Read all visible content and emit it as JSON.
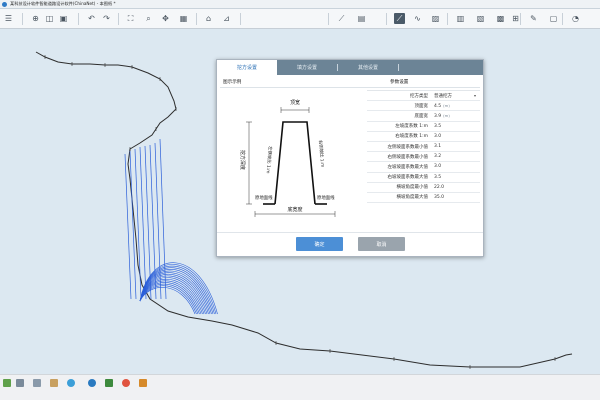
{
  "window": {
    "title": "某科技设计软件智能道路设计软件(ChinaNet) - 本图纸 *"
  },
  "toolbar": {
    "buttons": [
      {
        "name": "menu-icon",
        "glyph": "☰"
      },
      {
        "name": "target-icon",
        "glyph": "⊕"
      },
      {
        "name": "layers-icon",
        "glyph": "◫"
      },
      {
        "name": "save-icon",
        "glyph": "▣"
      },
      {
        "name": "undo-icon",
        "glyph": "↶"
      },
      {
        "name": "redo-icon",
        "glyph": "↷"
      },
      {
        "name": "extents-icon",
        "glyph": "⛶"
      },
      {
        "name": "zoom-icon",
        "glyph": "⌕"
      },
      {
        "name": "pan-icon",
        "glyph": "✥"
      },
      {
        "name": "grid-icon",
        "glyph": "▦"
      },
      {
        "name": "home-icon",
        "glyph": "⌂"
      },
      {
        "name": "section-icon",
        "glyph": "⊿"
      },
      {
        "name": "profile-icon",
        "glyph": "⟋"
      },
      {
        "name": "layout-icon",
        "glyph": "▤"
      },
      {
        "name": "slope-icon",
        "glyph": "⟋",
        "active": true
      },
      {
        "name": "curve-icon",
        "glyph": "∿"
      },
      {
        "name": "fill-icon",
        "glyph": "▨"
      },
      {
        "name": "table-icon",
        "glyph": "▥"
      },
      {
        "name": "chart-icon",
        "glyph": "▧"
      },
      {
        "name": "volume-icon",
        "glyph": "▩"
      },
      {
        "name": "measure-icon",
        "glyph": "⊞"
      },
      {
        "name": "edit-icon",
        "glyph": "✎"
      },
      {
        "name": "export-icon",
        "glyph": "▢"
      },
      {
        "name": "help-icon",
        "glyph": "◔"
      }
    ]
  },
  "dialog": {
    "tabs": [
      {
        "label": "挖方设置",
        "active": true
      },
      {
        "label": "填方设置",
        "active": false
      },
      {
        "label": "其他设置",
        "active": false
      }
    ],
    "left_section_title": "图示示例",
    "right_section_title": "参数设置",
    "diagram_labels": {
      "top_width": "顶宽",
      "bottom_width": "底宽度",
      "left_height": "挖方深度",
      "left_slope": "左侧坡比 1:m",
      "right_slope": "右侧坡比 1:m",
      "left_foot": "原地面线",
      "right_foot": "原地面线"
    },
    "params": [
      {
        "label": "挖方类型",
        "value": "普通挖方",
        "dropdown": true
      },
      {
        "label": "顶面宽",
        "value": "4.5",
        "unit": "(m)"
      },
      {
        "label": "底面宽",
        "value": "3.9",
        "unit": "(m)"
      },
      {
        "label": "左坡度系数 1:m",
        "value": "3.5"
      },
      {
        "label": "右坡度系数 1:m",
        "value": "3.0"
      },
      {
        "label": "左侧坡面系数最小值",
        "value": "3.1"
      },
      {
        "label": "右侧坡面系数最小值",
        "value": "3.2"
      },
      {
        "label": "左坡坡面系数最大值",
        "value": "3.0"
      },
      {
        "label": "右坡坡面系数最大值",
        "value": "3.5"
      },
      {
        "label": "横坡角度最小值",
        "value": "22.0"
      },
      {
        "label": "横坡角度最大值",
        "value": "35.0"
      }
    ],
    "ok_label": "确定",
    "cancel_label": "取消"
  },
  "colors": {
    "accent": "#4c8fd6",
    "section_lines": "#2b5fd9",
    "road_line": "#2d2d2d"
  }
}
